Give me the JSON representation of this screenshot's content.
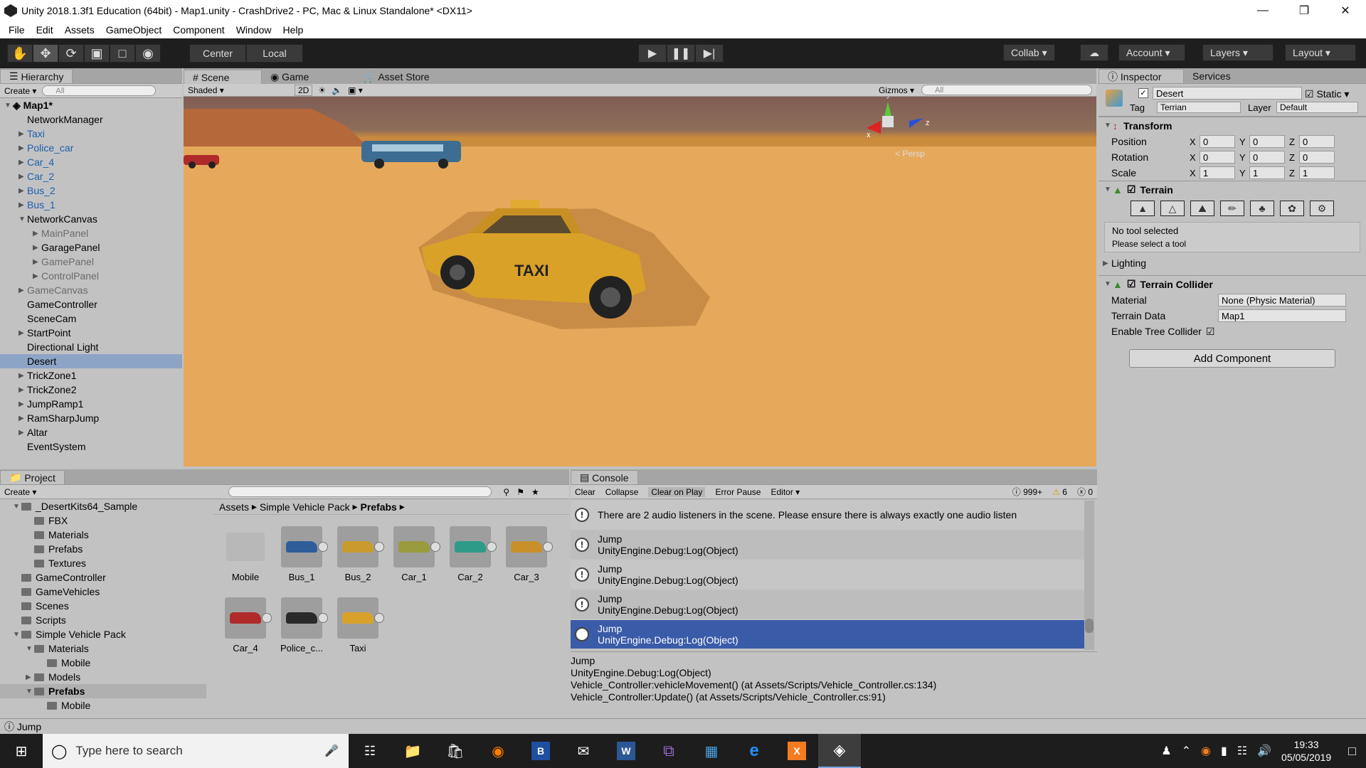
{
  "window": {
    "title": "Unity 2018.1.3f1 Education (64bit) - Map1.unity - CrashDrive2 - PC, Mac & Linux Standalone* <DX11>"
  },
  "menu": [
    "File",
    "Edit",
    "Assets",
    "GameObject",
    "Component",
    "Window",
    "Help"
  ],
  "toolbar": {
    "center": "Center",
    "local": "Local",
    "collab": "Collab",
    "account": "Account",
    "layers": "Layers",
    "layout": "Layout"
  },
  "hierarchy": {
    "tab": "Hierarchy",
    "create": "Create",
    "search_placeholder": "All",
    "scene": "Map1*",
    "items": [
      {
        "label": "NetworkManager",
        "indent": 1,
        "arrow": false,
        "color": "black"
      },
      {
        "label": "Taxi",
        "indent": 1,
        "arrow": true,
        "color": "blue"
      },
      {
        "label": "Police_car",
        "indent": 1,
        "arrow": true,
        "color": "blue"
      },
      {
        "label": "Car_4",
        "indent": 1,
        "arrow": true,
        "color": "blue"
      },
      {
        "label": "Car_2",
        "indent": 1,
        "arrow": true,
        "color": "blue"
      },
      {
        "label": "Bus_2",
        "indent": 1,
        "arrow": true,
        "color": "blue"
      },
      {
        "label": "Bus_1",
        "indent": 1,
        "arrow": true,
        "color": "blue"
      },
      {
        "label": "NetworkCanvas",
        "indent": 1,
        "arrow": true,
        "open": true,
        "color": "black"
      },
      {
        "label": "MainPanel",
        "indent": 2,
        "arrow": true,
        "color": "gray"
      },
      {
        "label": "GaragePanel",
        "indent": 2,
        "arrow": true,
        "color": "black"
      },
      {
        "label": "GamePanel",
        "indent": 2,
        "arrow": true,
        "color": "gray"
      },
      {
        "label": "ControlPanel",
        "indent": 2,
        "arrow": true,
        "color": "gray"
      },
      {
        "label": "GameCanvas",
        "indent": 1,
        "arrow": true,
        "color": "gray"
      },
      {
        "label": "GameController",
        "indent": 1,
        "arrow": false,
        "color": "black"
      },
      {
        "label": "SceneCam",
        "indent": 1,
        "arrow": false,
        "color": "black"
      },
      {
        "label": "StartPoint",
        "indent": 1,
        "arrow": true,
        "color": "black"
      },
      {
        "label": "Directional Light",
        "indent": 1,
        "arrow": false,
        "color": "black"
      },
      {
        "label": "Desert",
        "indent": 1,
        "arrow": false,
        "color": "black",
        "selected": true
      },
      {
        "label": "TrickZone1",
        "indent": 1,
        "arrow": true,
        "color": "black"
      },
      {
        "label": "TrickZone2",
        "indent": 1,
        "arrow": true,
        "color": "black"
      },
      {
        "label": "JumpRamp1",
        "indent": 1,
        "arrow": true,
        "color": "black"
      },
      {
        "label": "RamSharpJump",
        "indent": 1,
        "arrow": true,
        "color": "black"
      },
      {
        "label": "Altar",
        "indent": 1,
        "arrow": true,
        "color": "black"
      },
      {
        "label": "EventSystem",
        "indent": 1,
        "arrow": false,
        "color": "black"
      }
    ]
  },
  "scene_tabs": {
    "scene": "Scene",
    "game": "Game",
    "asset_store": "Asset Store",
    "shaded": "Shaded",
    "twod": "2D",
    "gizmos": "Gizmos",
    "search_placeholder": "All"
  },
  "scene_view": {
    "persp": "< Persp",
    "taxi_sign": "TAXI"
  },
  "inspector": {
    "tab": "Inspector",
    "services": "Services",
    "object_name": "Desert",
    "static": "Static",
    "tag_label": "Tag",
    "tag": "Terrian",
    "layer_label": "Layer",
    "layer": "Default",
    "transform": "Transform",
    "rows": [
      {
        "label": "Position",
        "x": "0",
        "y": "0",
        "z": "0"
      },
      {
        "label": "Rotation",
        "x": "0",
        "y": "0",
        "z": "0"
      },
      {
        "label": "Scale",
        "x": "1",
        "y": "1",
        "z": "1"
      }
    ],
    "terrain": "Terrain",
    "no_tool": "No tool selected",
    "select_tool": "Please select a tool",
    "lighting": "Lighting",
    "terrain_collider": "Terrain Collider",
    "material_label": "Material",
    "material": "None (Physic Material)",
    "terrain_data_label": "Terrain Data",
    "terrain_data": "Map1",
    "tree_collider": "Enable Tree Collider",
    "add_component": "Add Component"
  },
  "project": {
    "tab": "Project",
    "create": "Create",
    "tree": [
      {
        "label": "_DesertKits64_Sample",
        "indent": 1,
        "open": true
      },
      {
        "label": "FBX",
        "indent": 2
      },
      {
        "label": "Materials",
        "indent": 2
      },
      {
        "label": "Prefabs",
        "indent": 2
      },
      {
        "label": "Textures",
        "indent": 2
      },
      {
        "label": "GameController",
        "indent": 1
      },
      {
        "label": "GameVehicles",
        "indent": 1
      },
      {
        "label": "Scenes",
        "indent": 1
      },
      {
        "label": "Scripts",
        "indent": 1
      },
      {
        "label": "Simple Vehicle Pack",
        "indent": 1,
        "open": true
      },
      {
        "label": "Materials",
        "indent": 2,
        "open": true
      },
      {
        "label": "Mobile",
        "indent": 3
      },
      {
        "label": "Models",
        "indent": 2,
        "closed": true
      },
      {
        "label": "Prefabs",
        "indent": 2,
        "open": true,
        "selected": true
      },
      {
        "label": "Mobile",
        "indent": 3
      }
    ],
    "breadcrumb": [
      "Assets",
      "Simple Vehicle Pack",
      "Prefabs"
    ],
    "assets": [
      {
        "label": "Mobile",
        "color": "#b8b8b8",
        "folder": true
      },
      {
        "label": "Bus_1",
        "color": "#2e5d99"
      },
      {
        "label": "Bus_2",
        "color": "#c99a2e"
      },
      {
        "label": "Car_1",
        "color": "#9a9a3e"
      },
      {
        "label": "Car_2",
        "color": "#2e9a88"
      },
      {
        "label": "Car_3",
        "color": "#c98f2a"
      },
      {
        "label": "Car_4",
        "color": "#b02a2a"
      },
      {
        "label": "Police_c...",
        "color": "#2a2a2a"
      },
      {
        "label": "Taxi",
        "color": "#d8a22a"
      }
    ]
  },
  "console": {
    "tab": "Console",
    "clear": "Clear",
    "collapse": "Collapse",
    "clear_on_play": "Clear on Play",
    "error_pause": "Error Pause",
    "editor": "Editor",
    "count_log": "999+",
    "count_warn": "6",
    "count_err": "0",
    "entries": [
      {
        "l1": "There are 2 audio listeners in the scene. Please ensure there is always exactly one audio listen",
        "l2": ""
      },
      {
        "l1": "Jump",
        "l2": "UnityEngine.Debug:Log(Object)"
      },
      {
        "l1": "Jump",
        "l2": "UnityEngine.Debug:Log(Object)"
      },
      {
        "l1": "Jump",
        "l2": "UnityEngine.Debug:Log(Object)"
      },
      {
        "l1": "Jump",
        "l2": "UnityEngine.Debug:Log(Object)",
        "selected": true
      }
    ],
    "detail": [
      "Jump",
      "UnityEngine.Debug:Log(Object)",
      "Vehicle_Controller:vehicleMovement() (at Assets/Scripts/Vehicle_Controller.cs:134)",
      "Vehicle_Controller:Update() (at Assets/Scripts/Vehicle_Controller.cs:91)"
    ]
  },
  "statusbar": {
    "text": "Jump"
  },
  "taskbar": {
    "search_placeholder": "Type here to search",
    "time": "19:33",
    "date": "05/05/2019"
  }
}
